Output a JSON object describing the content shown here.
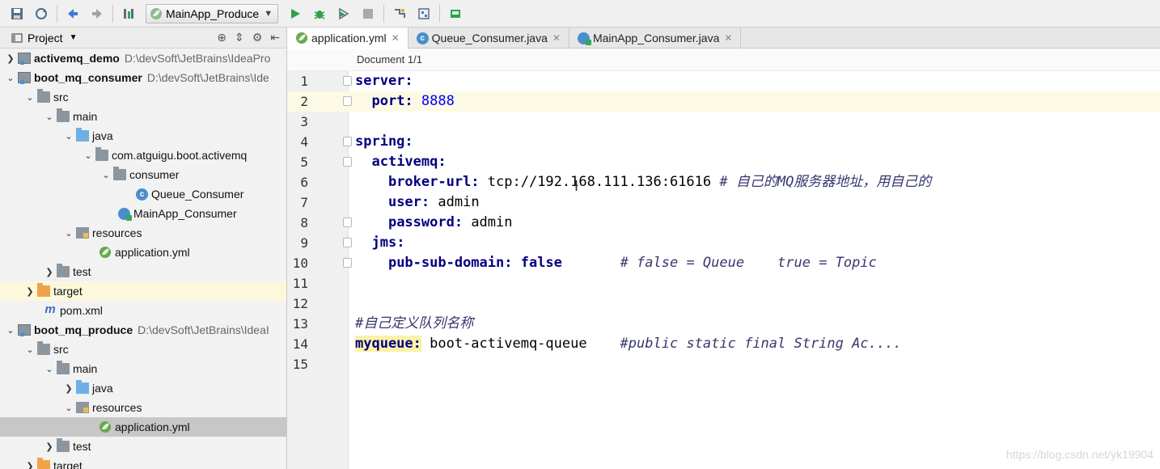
{
  "toolbar": {
    "run_config": "MainApp_Produce",
    "icons": [
      "save-icon",
      "sync-icon",
      "back-icon",
      "forward-icon",
      "build-icon",
      "run-icon",
      "debug-icon",
      "coverage-icon",
      "stop-icon",
      "project-structure-icon",
      "sdk-icon",
      "terminal-icon"
    ]
  },
  "project_panel": {
    "title": "Project",
    "tree": [
      {
        "label": "activemq_demo",
        "path": "D:\\devSoft\\JetBrains\\IdeaPro"
      },
      {
        "label": "boot_mq_consumer",
        "path": "D:\\devSoft\\JetBrains\\Ide"
      },
      {
        "label": "src"
      },
      {
        "label": "main"
      },
      {
        "label": "java"
      },
      {
        "label": "com.atguigu.boot.activemq"
      },
      {
        "label": "consumer"
      },
      {
        "label": "Queue_Consumer"
      },
      {
        "label": "MainApp_Consumer"
      },
      {
        "label": "resources"
      },
      {
        "label": "application.yml"
      },
      {
        "label": "test"
      },
      {
        "label": "target"
      },
      {
        "label": "pom.xml"
      },
      {
        "label": "boot_mq_produce",
        "path": "D:\\devSoft\\JetBrains\\IdeaI"
      },
      {
        "label": "src"
      },
      {
        "label": "main"
      },
      {
        "label": "java"
      },
      {
        "label": "resources"
      },
      {
        "label": "application.yml"
      },
      {
        "label": "test"
      },
      {
        "label": "target"
      }
    ]
  },
  "editor": {
    "tabs": [
      {
        "label": "application.yml",
        "active": true
      },
      {
        "label": "Queue_Consumer.java",
        "active": false
      },
      {
        "label": "MainApp_Consumer.java",
        "active": false
      }
    ],
    "breadcrumb": "Document 1/1",
    "line_numbers": [
      "1",
      "2",
      "3",
      "4",
      "5",
      "6",
      "7",
      "8",
      "9",
      "10",
      "11",
      "12",
      "13",
      "14",
      "15"
    ],
    "code": {
      "l1_key": "server:",
      "l2_key": "port:",
      "l2_val": " 8888",
      "l4_key": "spring:",
      "l5_key": "activemq:",
      "l6_key": "broker-url:",
      "l6_val": " tcp://192.168.111.136:61616 ",
      "l6_comment": "# 自己的MQ服务器地址，用自己的",
      "l7_key": "user:",
      "l7_val": " admin",
      "l8_key": "password:",
      "l8_val": " admin",
      "l9_key": "jms:",
      "l10_key": "pub-sub-domain:",
      "l10_val": " false",
      "l10_comment": "# false = Queue    true = Topic",
      "l13_comment": "#自己定义队列名称",
      "l14_key": "myqueue:",
      "l14_val": " boot-activemq-queue",
      "l14_comment": "#public static final String Ac...."
    }
  },
  "watermark": "https://blog.csdn.net/yk19904"
}
